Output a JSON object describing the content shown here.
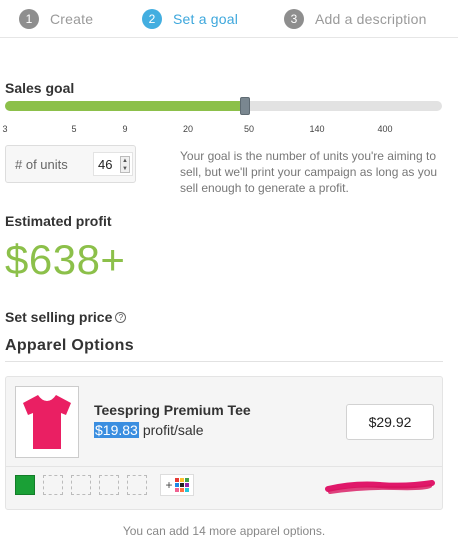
{
  "steps": [
    {
      "number": "1",
      "label": "Create"
    },
    {
      "number": "2",
      "label": "Set a goal"
    },
    {
      "number": "3",
      "label": "Add a description"
    }
  ],
  "sales_goal": {
    "title": "Sales goal",
    "ticks": [
      "3",
      "5",
      "9",
      "20",
      "50",
      "140",
      "400"
    ],
    "slider_value_fraction": 0.55
  },
  "units": {
    "label": "# of units",
    "value": "46"
  },
  "goal_description": "Your goal is the number of units you're aiming to sell, but we'll print your campaign as long as you sell enough to generate a profit.",
  "estimated_profit": {
    "label": "Estimated profit",
    "value": "$638+"
  },
  "selling_price": {
    "label": "Set selling price",
    "help_icon": "?"
  },
  "apparel": {
    "heading": "Apparel Options",
    "product": {
      "name": "Teespring Premium Tee",
      "profit_amount": "$19.83",
      "profit_suffix": "profit/sale",
      "price": "$29.92",
      "shirt_color": "#ea1f63",
      "selected_swatch_color": "#1aa036"
    },
    "footer_note": "You can add 14 more apparel options."
  },
  "colors": {
    "accent_blue": "#43aee0",
    "accent_green": "#8cc04a"
  }
}
